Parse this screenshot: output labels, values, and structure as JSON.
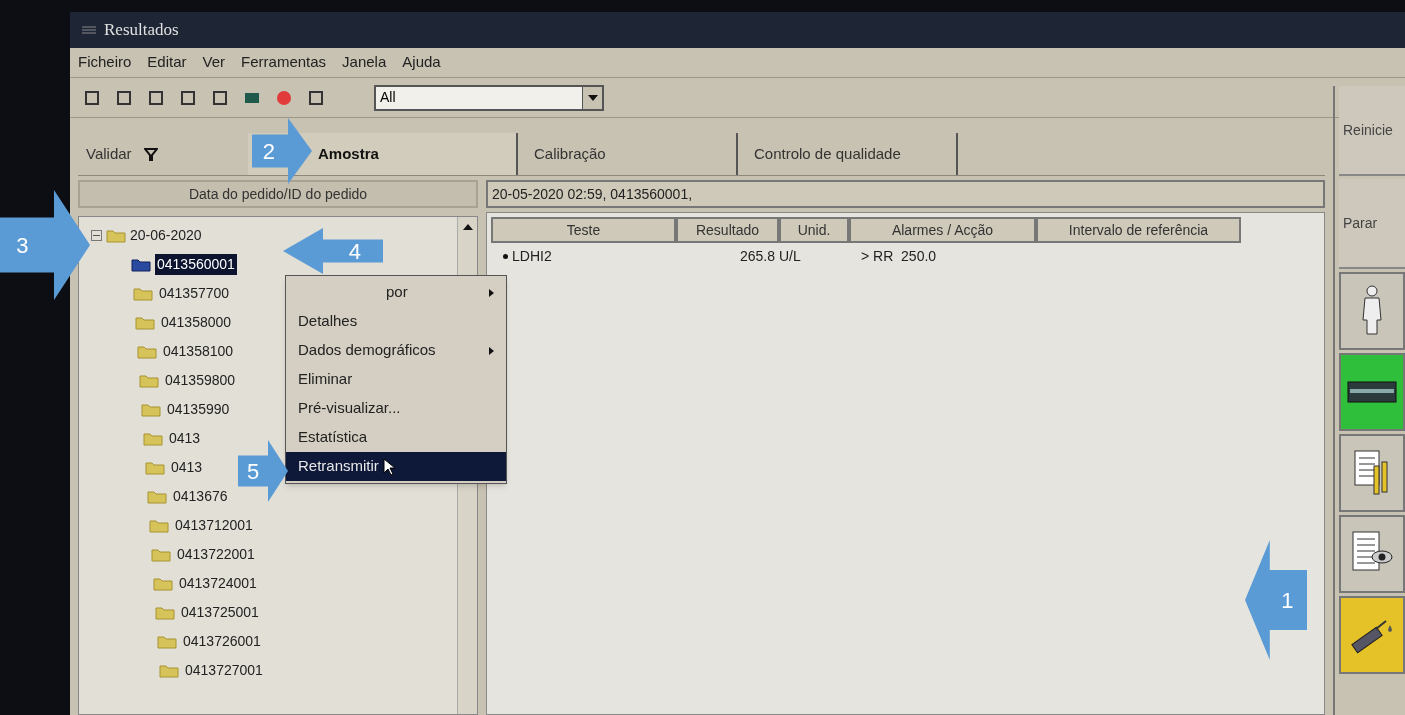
{
  "window": {
    "title": "Resultados"
  },
  "menu": [
    "Ficheiro",
    "Editar",
    "Ver",
    "Ferramentas",
    "Janela",
    "Ajuda"
  ],
  "toolbar": {
    "filter": "All"
  },
  "validate": {
    "label": "Validar"
  },
  "tabs": [
    {
      "label": "Amostra",
      "selected": true
    },
    {
      "label": "Calibração",
      "selected": false
    },
    {
      "label": "Controlo de qualidade",
      "selected": false
    }
  ],
  "tree": {
    "header": "Data do pedido/ID do pedido",
    "root": {
      "label": "20-06-2020",
      "expanded": true,
      "children": [
        {
          "label": "0413560001",
          "selected": true
        },
        {
          "label": "041357700",
          "selected": false
        },
        {
          "label": "041358000",
          "selected": false
        },
        {
          "label": "041358100",
          "selected": false
        },
        {
          "label": "041359800",
          "selected": false
        },
        {
          "label": "04135990",
          "selected": false
        },
        {
          "label": "0413",
          "selected": false
        },
        {
          "label": "0413",
          "selected": false
        },
        {
          "label": "0413676",
          "selected": false
        },
        {
          "label": "0413712001",
          "selected": false
        },
        {
          "label": "0413722001",
          "selected": false
        },
        {
          "label": "0413724001",
          "selected": false
        },
        {
          "label": "0413725001",
          "selected": false
        },
        {
          "label": "0413726001",
          "selected": false
        },
        {
          "label": "0413727001",
          "selected": false
        }
      ]
    }
  },
  "context_menu": [
    {
      "label": "por",
      "submenu": true,
      "selected": false
    },
    {
      "label": "Detalhes",
      "submenu": false,
      "selected": false
    },
    {
      "label": "Dados demográficos",
      "submenu": true,
      "selected": false
    },
    {
      "label": "Eliminar",
      "submenu": false,
      "selected": false
    },
    {
      "label": "Pré-visualizar...",
      "submenu": false,
      "selected": false
    },
    {
      "label": "Estatística",
      "submenu": false,
      "selected": false
    },
    {
      "label": "Retransmitir",
      "submenu": false,
      "selected": true
    }
  ],
  "results": {
    "summary": "20-05-2020 02:59, 0413560001,",
    "columns": [
      "Teste",
      "Resultado",
      "Unid.",
      "Alarmes / Acção",
      "Intervalo de referência"
    ],
    "rows": [
      {
        "test": "LDHI2",
        "result": "265.8",
        "unit": "U/L",
        "alarm": "> RR  250.0"
      }
    ]
  },
  "side_buttons": [
    {
      "kind": "text",
      "label": "Reinicie"
    },
    {
      "kind": "text",
      "label": "Parar"
    },
    {
      "kind": "person",
      "color": "#c9c5b9"
    },
    {
      "kind": "instrument",
      "color": "#2fbf3a"
    },
    {
      "kind": "report-tubes",
      "color": "#c9c5b9"
    },
    {
      "kind": "report-eye",
      "color": "#c9c5b9"
    },
    {
      "kind": "pipette",
      "color": "#e6c229"
    }
  ],
  "annotations": [
    {
      "label": "1"
    },
    {
      "label": "2"
    },
    {
      "label": "3"
    },
    {
      "label": "4"
    },
    {
      "label": "5"
    }
  ]
}
